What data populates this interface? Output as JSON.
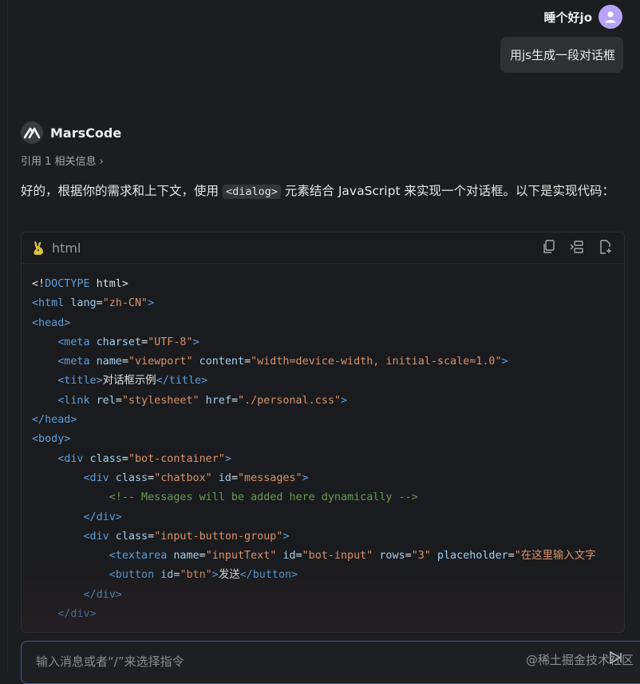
{
  "user": {
    "name": "睡个好jo",
    "message": "用js生成一段对话框"
  },
  "bot": {
    "name": "MarsCode",
    "reference": "引用 1 相关信息",
    "answer_before": "好的，根据你的需求和上下文，使用 ",
    "answer_code": "<dialog>",
    "answer_after": " 元素结合 JavaScript 来实现一个对话框。以下是实现代码："
  },
  "code_block": {
    "language": "html",
    "tool_icons": [
      "copy-icon",
      "insert-icon",
      "new-file-icon"
    ],
    "lines": [
      [
        [
          "t-text",
          "<!"
        ],
        [
          "t-kw",
          "DOCTYPE"
        ],
        [
          "t-text",
          " html>"
        ]
      ],
      [
        [
          "t-tag",
          "<html"
        ],
        [
          "t-attr",
          " lang"
        ],
        [
          "t-text",
          "="
        ],
        [
          "t-str",
          "\"zh-CN\""
        ],
        [
          "t-tag",
          ">"
        ]
      ],
      [
        [
          "t-tag",
          "<head>"
        ]
      ],
      [
        [
          "t-text",
          "    "
        ],
        [
          "t-tag",
          "<meta"
        ],
        [
          "t-attr",
          " charset"
        ],
        [
          "t-text",
          "="
        ],
        [
          "t-str",
          "\"UTF-8\""
        ],
        [
          "t-tag",
          ">"
        ]
      ],
      [
        [
          "t-text",
          "    "
        ],
        [
          "t-tag",
          "<meta"
        ],
        [
          "t-attr",
          " name"
        ],
        [
          "t-text",
          "="
        ],
        [
          "t-str",
          "\"viewport\""
        ],
        [
          "t-attr",
          " content"
        ],
        [
          "t-text",
          "="
        ],
        [
          "t-str",
          "\"width=device-width, initial-scale=1.0\""
        ],
        [
          "t-tag",
          ">"
        ]
      ],
      [
        [
          "t-text",
          "    "
        ],
        [
          "t-tag",
          "<title>"
        ],
        [
          "t-text",
          "对话框示例"
        ],
        [
          "t-tag",
          "</title>"
        ]
      ],
      [
        [
          "t-text",
          "    "
        ],
        [
          "t-tag",
          "<link"
        ],
        [
          "t-attr",
          " rel"
        ],
        [
          "t-text",
          "="
        ],
        [
          "t-str",
          "\"stylesheet\""
        ],
        [
          "t-attr",
          " href"
        ],
        [
          "t-text",
          "="
        ],
        [
          "t-str",
          "\"./personal.css\""
        ],
        [
          "t-tag",
          ">"
        ]
      ],
      [
        [
          "t-tag",
          "</head>"
        ]
      ],
      [
        [
          "t-tag",
          "<body>"
        ]
      ],
      [
        [
          "t-text",
          "    "
        ],
        [
          "t-tag",
          "<div"
        ],
        [
          "t-attr",
          " class"
        ],
        [
          "t-text",
          "="
        ],
        [
          "t-str",
          "\"bot-container\""
        ],
        [
          "t-tag",
          ">"
        ]
      ],
      [
        [
          "t-text",
          "        "
        ],
        [
          "t-tag",
          "<div"
        ],
        [
          "t-attr",
          " class"
        ],
        [
          "t-text",
          "="
        ],
        [
          "t-str",
          "\"chatbox\""
        ],
        [
          "t-attr",
          " id"
        ],
        [
          "t-text",
          "="
        ],
        [
          "t-str",
          "\"messages\""
        ],
        [
          "t-tag",
          ">"
        ]
      ],
      [
        [
          "t-text",
          "            "
        ],
        [
          "t-com",
          "<!-- Messages will be added here dynamically -->"
        ]
      ],
      [
        [
          "t-text",
          "        "
        ],
        [
          "t-tag",
          "</div>"
        ]
      ],
      [
        [
          "t-text",
          "        "
        ],
        [
          "t-tag",
          "<div"
        ],
        [
          "t-attr",
          " class"
        ],
        [
          "t-text",
          "="
        ],
        [
          "t-str",
          "\"input-button-group\""
        ],
        [
          "t-tag",
          ">"
        ]
      ],
      [
        [
          "t-text",
          "            "
        ],
        [
          "t-tag",
          "<textarea"
        ],
        [
          "t-attr",
          " name"
        ],
        [
          "t-text",
          "="
        ],
        [
          "t-str",
          "\"inputText\""
        ],
        [
          "t-attr",
          " id"
        ],
        [
          "t-text",
          "="
        ],
        [
          "t-str",
          "\"bot-input\""
        ],
        [
          "t-attr",
          " rows"
        ],
        [
          "t-text",
          "="
        ],
        [
          "t-str",
          "\"3\""
        ],
        [
          "t-attr",
          " placeholder"
        ],
        [
          "t-text",
          "="
        ],
        [
          "t-str",
          "\"在这里输入文字"
        ]
      ],
      [
        [
          "t-text",
          "            "
        ],
        [
          "t-tag",
          "<button"
        ],
        [
          "t-attr",
          " id"
        ],
        [
          "t-text",
          "="
        ],
        [
          "t-str",
          "\"btn\""
        ],
        [
          "t-tag",
          ">"
        ],
        [
          "t-text",
          "发送"
        ],
        [
          "t-tag",
          "</button>"
        ]
      ],
      [
        [
          "t-text",
          "        "
        ],
        [
          "t-tag",
          "</div>"
        ]
      ],
      [
        [
          "t-text",
          "    "
        ],
        [
          "t-tag",
          "</div>"
        ]
      ]
    ]
  },
  "input": {
    "placeholder": "输入消息或者“/”来选择指令"
  },
  "watermark": "@稀土掘金技术社区",
  "colors": {
    "background": "#1c1d20",
    "avatar": "#b6a3f7",
    "input_border": "#3d5f9e"
  }
}
